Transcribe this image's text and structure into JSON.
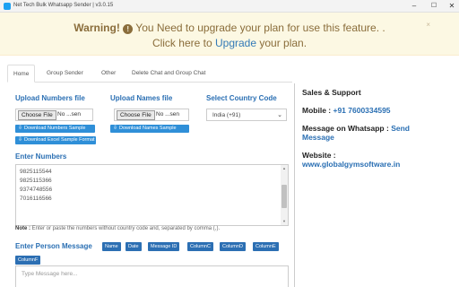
{
  "window": {
    "title": "Net Tech Bulk Whatsapp Sender | v3.0.15",
    "controls": [
      "minimize",
      "maximize",
      "close"
    ]
  },
  "warning": {
    "icon": "exclamation-circle-icon",
    "strong": "Warning!",
    "line1_text": "You Need to upgrade your plan for use this feature. .",
    "line2_prefix": "Click here to",
    "line2_link": "Upgrade",
    "line2_suffix": "your plan.",
    "close": "×"
  },
  "tabs": [
    {
      "label": "Home",
      "active": true
    },
    {
      "label": "Group Sender"
    },
    {
      "label": "Other"
    },
    {
      "label": "Delete Chat and Group Chat"
    }
  ],
  "upload_numbers": {
    "label": "Upload Numbers file",
    "choose_label": "Choose File",
    "file_text": "No ...sen",
    "btn_sample": "Download Numbers Sample",
    "btn_excel": "Download Excel Sample Format"
  },
  "upload_names": {
    "label": "Upload Names file",
    "choose_label": "Choose File",
    "file_text": "No ...sen",
    "btn_sample": "Download Names Sample"
  },
  "country": {
    "label": "Select Country Code",
    "selected": "India (+91)"
  },
  "numbers": {
    "label": "Enter Numbers",
    "values": [
      "9825115544",
      "9825115366",
      "9374748556",
      "7016116566"
    ]
  },
  "note": {
    "bold": "Note :",
    "text": "Enter or paste the numbers without country code and, separated by comma (,)."
  },
  "message": {
    "label": "Enter Person Message",
    "chips": [
      "Name",
      "Date",
      "Message ID",
      "ColumnC",
      "ColumnD",
      "ColumnE",
      "ColumnF"
    ],
    "placeholder": "Type Message here..."
  },
  "sidebar": {
    "title": "Sales & Support",
    "mobile_label": "Mobile :",
    "mobile_value": "+91 7600334595",
    "wa_label": "Message on Whatsapp :",
    "wa_link_part1": "Send",
    "wa_link_part2": "Message",
    "web_label": "Website :",
    "web_value": "www.globalgymsoftware.in"
  },
  "colors": {
    "accent": "#2a6fb3",
    "button_blue": "#2f8fd8",
    "warning_bg": "#fcf8e3",
    "warning_text": "#8a6d3b"
  }
}
